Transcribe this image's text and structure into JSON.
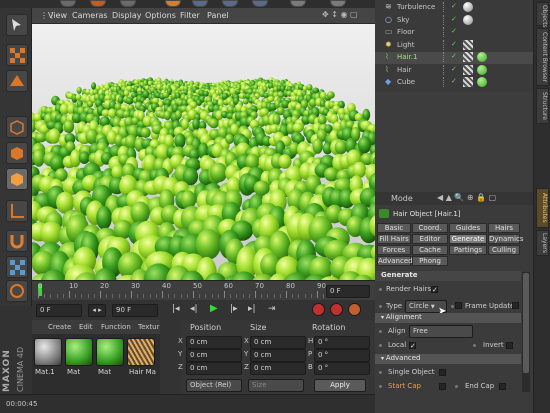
{
  "viewport_menu": [
    "View",
    "Cameras",
    "Display",
    "Options",
    "Filter",
    "Panel"
  ],
  "timeline": {
    "ticks": [
      "0",
      "10",
      "20",
      "30",
      "40",
      "50",
      "60",
      "70",
      "80",
      "90"
    ],
    "current_frame": "0 F"
  },
  "controls": {
    "start_frame": "0 F",
    "end_frame": "90 F"
  },
  "material_manager": {
    "menu": [
      "Create",
      "Edit",
      "Function",
      "Textur"
    ],
    "materials": [
      {
        "label": "Mat.1",
        "color": "#8a8a8a"
      },
      {
        "label": "Mat",
        "color": "#3fa52a"
      },
      {
        "label": "Mat",
        "color": "#3fa52a"
      },
      {
        "label": "Hair Ma",
        "color": "#b08a4a"
      }
    ]
  },
  "coordinates": {
    "headers": [
      "Position",
      "Size",
      "Rotation"
    ],
    "rows": [
      {
        "axis": "X",
        "pos": "0 cm",
        "size_axis": "X",
        "size": "0 cm",
        "rot_axis": "H",
        "rot": "0 °"
      },
      {
        "axis": "Y",
        "pos": "0 cm",
        "size_axis": "Y",
        "size": "0 cm",
        "rot_axis": "P",
        "rot": "0 °"
      },
      {
        "axis": "Z",
        "pos": "0 cm",
        "size_axis": "Z",
        "size": "0 cm",
        "rot_axis": "B",
        "rot": "0 °"
      }
    ],
    "mode_select": "Object (Rel)",
    "size_select": "Size",
    "apply_label": "Apply"
  },
  "status_time": "00:00:45",
  "logo": {
    "brand": "MAXON",
    "product": "CINEMA 4D"
  },
  "objects": [
    {
      "name": "Turbulence",
      "color": "#c8c8c8"
    },
    {
      "name": "Sky",
      "color": "#c8c8c8"
    },
    {
      "name": "Floor",
      "color": "#c8c8c8"
    },
    {
      "name": "Light",
      "color": "#c8c8c8"
    },
    {
      "name": "Hair.1",
      "color": "#a6e07a"
    },
    {
      "name": "Hair",
      "color": "#c8c8c8"
    },
    {
      "name": "Cube",
      "color": "#c8c8c8"
    }
  ],
  "right_tabs": [
    "Objects",
    "Content Browser",
    "Structure",
    "Attributes",
    "Layers"
  ],
  "attributes": {
    "mode_label": "Mode",
    "object_title": "Hair Object [Hair.1]",
    "tabs": [
      "Basic",
      "Coord.",
      "Guides",
      "Hairs",
      "Fill Hairs",
      "Editor",
      "Generate",
      "Dynamics",
      "Forces",
      "Cache",
      "Partings",
      "Culling",
      "Advanced",
      "Phong"
    ],
    "active_tab": "Generate",
    "section_generate": "Generate",
    "render_hairs": "Render Hairs",
    "render_hairs_check": "✓",
    "type_label": "Type",
    "type_value": "Circle",
    "frame_update": "Frame Update",
    "alignment_header": "Alignment",
    "align_label": "Align",
    "align_value": "Free",
    "local_label": "Local",
    "local_check": "✓",
    "invert_label": "Invert",
    "advanced_header": "Advanced",
    "single_object": "Single Object",
    "start_cap": "Start Cap",
    "end_cap": "End Cap"
  }
}
